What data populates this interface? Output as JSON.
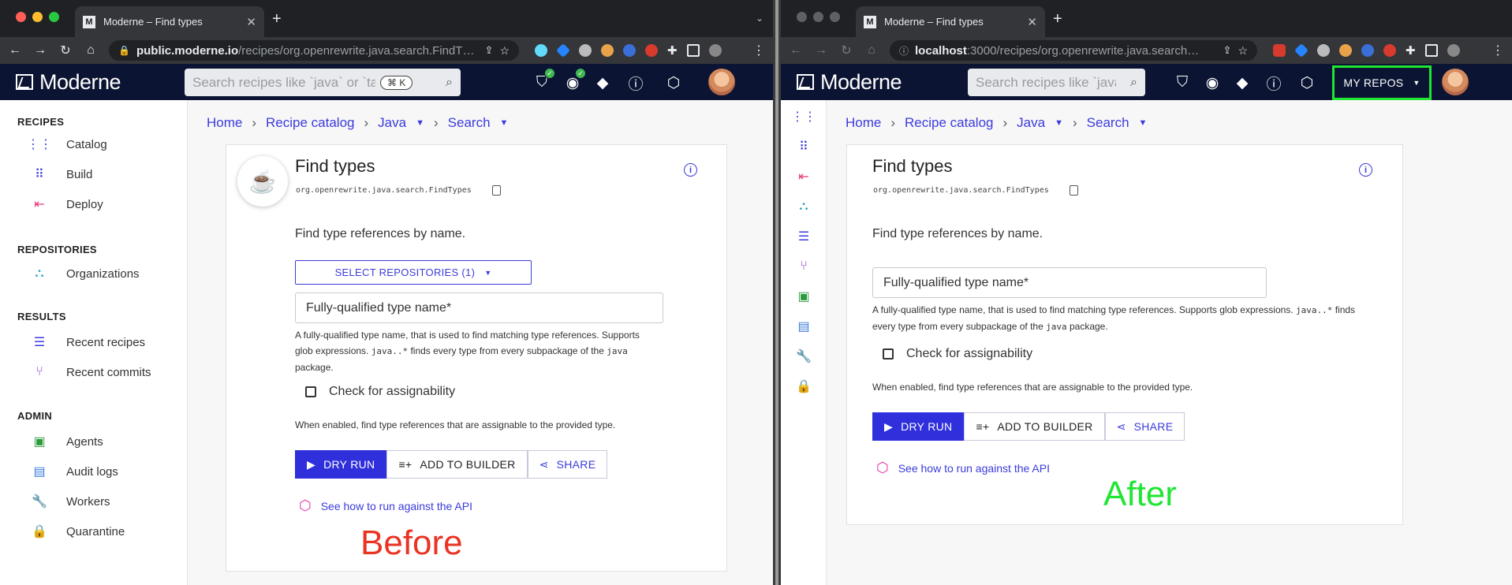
{
  "tab_title": "Moderne – Find types",
  "before": {
    "url_host": "public.moderne.io",
    "url_path": "/recipes/org.openrewrite.java.search.FindT…",
    "search_placeholder": "Search recipes like `java` or `ta",
    "search_shortcut": "⌘ K",
    "sidebar": {
      "sections": [
        {
          "title": "RECIPES",
          "items": [
            {
              "label": "Catalog",
              "icon": "catalog-icon"
            },
            {
              "label": "Build",
              "icon": "build-icon"
            },
            {
              "label": "Deploy",
              "icon": "deploy-icon"
            }
          ]
        },
        {
          "title": "REPOSITORIES",
          "items": [
            {
              "label": "Organizations",
              "icon": "organizations-icon"
            }
          ]
        },
        {
          "title": "RESULTS",
          "items": [
            {
              "label": "Recent recipes",
              "icon": "recent-recipes-icon"
            },
            {
              "label": "Recent commits",
              "icon": "recent-commits-icon"
            }
          ]
        },
        {
          "title": "ADMIN",
          "items": [
            {
              "label": "Agents",
              "icon": "agents-icon"
            },
            {
              "label": "Audit logs",
              "icon": "audit-logs-icon"
            },
            {
              "label": "Workers",
              "icon": "workers-icon"
            },
            {
              "label": "Quarantine",
              "icon": "quarantine-icon"
            }
          ]
        }
      ]
    },
    "select_repositories": "SELECT REPOSITORIES (1)",
    "caption": "Before"
  },
  "after": {
    "url_host": "localhost",
    "url_path": ":3000/recipes/org.openrewrite.java.search…",
    "search_placeholder": "Search recipes like `java",
    "my_repos": "MY REPOS",
    "caption": "After"
  },
  "logo_text": "Moderne",
  "breadcrumb": {
    "home": "Home",
    "catalog": "Recipe catalog",
    "java": "Java",
    "search": "Search"
  },
  "recipe": {
    "title": "Find types",
    "id": "org.openrewrite.java.search.FindTypes",
    "description": "Find type references by name.",
    "field_label": "Fully-qualified type name*",
    "help_text_1": "A fully-qualified type name, that is used to find matching type references. Supports glob expressions.",
    "help_code_1": "java..*",
    "help_text_2": "finds every type from every subpackage of the",
    "help_code_2": "java",
    "help_text_3": "package.",
    "check_label": "Check for assignability",
    "check_help": "When enabled, find type references that are assignable to the provided type.",
    "dry_run": "DRY RUN",
    "add_to_builder": "ADD TO BUILDER",
    "share": "SHARE",
    "api_link": "See how to run against the API"
  },
  "colors": {
    "header_bg": "#0b1432",
    "accent": "#2f2fdc",
    "highlight": "#1fe533",
    "before_label": "#ea3323"
  }
}
